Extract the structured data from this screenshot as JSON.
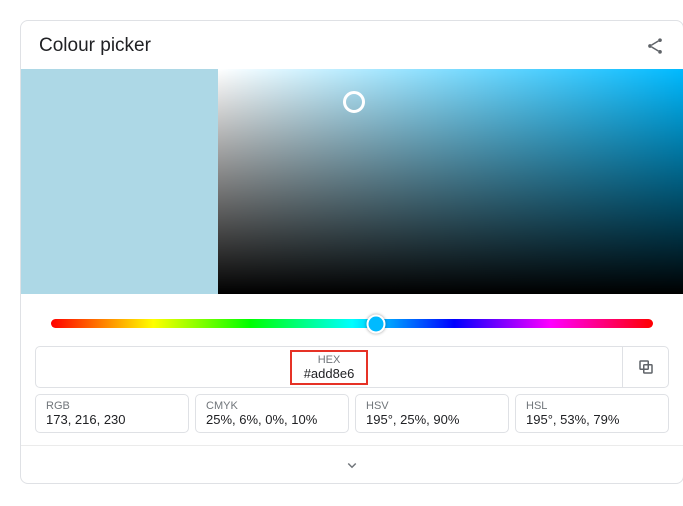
{
  "header": {
    "title": "Colour picker"
  },
  "swatch_color": "#add8e6",
  "hex": {
    "label": "HEX",
    "value": "#add8e6"
  },
  "formats": [
    {
      "label": "RGB",
      "value": "173, 216, 230"
    },
    {
      "label": "CMYK",
      "value": "25%, 6%, 0%, 10%"
    },
    {
      "label": "HSV",
      "value": "195°, 25%, 90%"
    },
    {
      "label": "HSL",
      "value": "195°, 53%, 79%"
    }
  ]
}
